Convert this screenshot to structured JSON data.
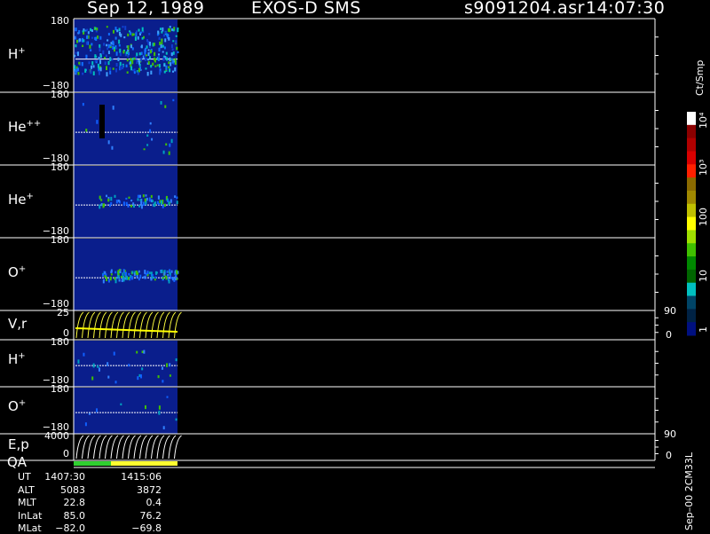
{
  "header": {
    "date": "Sep 12, 1989",
    "mission": "EXOS-D SMS",
    "file": "s9091204.asr",
    "time": "14:07:30"
  },
  "colorbar": {
    "title": "Ct/Smp",
    "labels": [
      "10⁴",
      "10³",
      "100",
      "10",
      "1"
    ],
    "colors": [
      "#ffffff",
      "#8b0000",
      "#b00000",
      "#d80000",
      "#ff2000",
      "#8a6a00",
      "#a08800",
      "#c0c000",
      "#ffff00",
      "#a0e000",
      "#40c000",
      "#008800",
      "#006600",
      "#00c0c0",
      "#004466",
      "#002244",
      "#001080"
    ]
  },
  "panels": [
    {
      "label": "H",
      "sup": "+",
      "top": "180",
      "bottom": "−180"
    },
    {
      "label": "He",
      "sup": "++",
      "top": "180",
      "bottom": "−180"
    },
    {
      "label": "He",
      "sup": "+",
      "top": "180",
      "bottom": "−180"
    },
    {
      "label": "O",
      "sup": "+",
      "top": "180",
      "bottom": "−180"
    },
    {
      "label": "V,r",
      "sup": "",
      "top": "25",
      "bottom": "0",
      "right_top": "90",
      "right_bottom": "0"
    },
    {
      "label": "H",
      "sup": "+",
      "top": "180",
      "bottom": "−180"
    },
    {
      "label": "O",
      "sup": "+",
      "top": "180",
      "bottom": "−180"
    },
    {
      "label": "E,p",
      "sup": "",
      "top": "4000",
      "bottom": "0",
      "right_top": "90",
      "right_bottom": "0"
    }
  ],
  "qa_label": "QA",
  "footer": {
    "rows": [
      {
        "name": "UT",
        "v1": "1407:30",
        "v2": "1415:06"
      },
      {
        "name": "ALT",
        "v1": "5083",
        "v2": "3872"
      },
      {
        "name": "MLT",
        "v1": "22.8",
        "v2": "0.4"
      },
      {
        "name": "InLat",
        "v1": "85.0",
        "v2": "76.2"
      },
      {
        "name": "MLat",
        "v1": "−82.0",
        "v2": "−69.8"
      }
    ],
    "side_text": "Sep–00 2CM33L"
  },
  "chart_data": {
    "type": "heatmap",
    "title": "Sep 12, 1989   EXOS-D SMS",
    "time_start": "1407:30",
    "time_end": "1415:06",
    "panels": [
      {
        "species": "H+",
        "ylim": [
          -180,
          180
        ]
      },
      {
        "species": "He++",
        "ylim": [
          -180,
          180
        ]
      },
      {
        "species": "He+",
        "ylim": [
          -180,
          180
        ]
      },
      {
        "species": "O+",
        "ylim": [
          -180,
          180
        ]
      },
      {
        "species": "V,r",
        "ylim": [
          0,
          25
        ],
        "ylim_right": [
          0,
          90
        ]
      },
      {
        "species": "H+",
        "ylim": [
          -180,
          180
        ]
      },
      {
        "species": "O+",
        "ylim": [
          -180,
          180
        ]
      },
      {
        "species": "E,p",
        "ylim": [
          0,
          4000
        ],
        "ylim_right": [
          0,
          90
        ]
      }
    ],
    "colorbar_unit": "Ct/Smp",
    "colorbar_ticks": [
      "1",
      "10",
      "100",
      "10³",
      "10⁴"
    ]
  }
}
